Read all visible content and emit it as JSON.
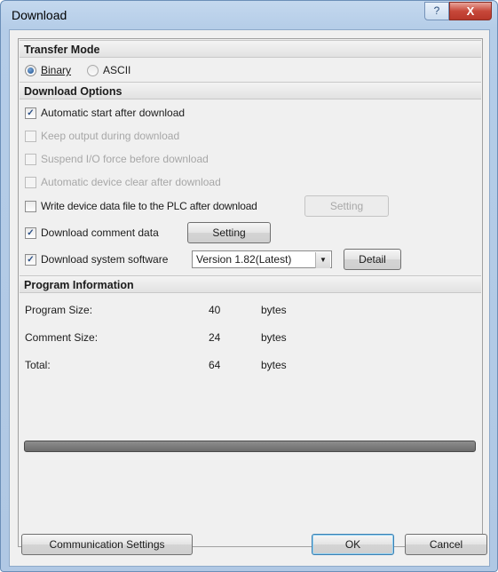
{
  "window": {
    "title": "Download",
    "help_glyph": "?",
    "close_glyph": "X"
  },
  "transfer_mode": {
    "header": "Transfer Mode",
    "options": [
      {
        "label": "Binary",
        "selected": true
      },
      {
        "label": "ASCII",
        "selected": false
      }
    ]
  },
  "download_options": {
    "header": "Download Options",
    "items": [
      {
        "label": "Automatic start after download",
        "checked": true,
        "enabled": true
      },
      {
        "label": "Keep output during download",
        "checked": false,
        "enabled": false
      },
      {
        "label": "Suspend I/O force before download",
        "checked": false,
        "enabled": false
      },
      {
        "label": "Automatic device clear after download",
        "checked": false,
        "enabled": false
      },
      {
        "label": "Write device data file to the PLC after download",
        "checked": false,
        "enabled": true
      },
      {
        "label": "Download comment data",
        "checked": true,
        "enabled": true
      },
      {
        "label": "Download system software",
        "checked": true,
        "enabled": true
      }
    ],
    "write_setting_button": "Setting",
    "comment_setting_button": "Setting",
    "version_select_value": "Version 1.82(Latest)",
    "detail_button": "Detail"
  },
  "program_info": {
    "header": "Program Information",
    "rows": [
      {
        "label": "Program Size:",
        "value": "40",
        "unit": "bytes"
      },
      {
        "label": "Comment Size:",
        "value": "24",
        "unit": "bytes"
      },
      {
        "label": "Total:",
        "value": "64",
        "unit": "bytes"
      }
    ],
    "progress": 0
  },
  "footer": {
    "communication_settings": "Communication Settings",
    "ok": "OK",
    "cancel": "Cancel"
  }
}
